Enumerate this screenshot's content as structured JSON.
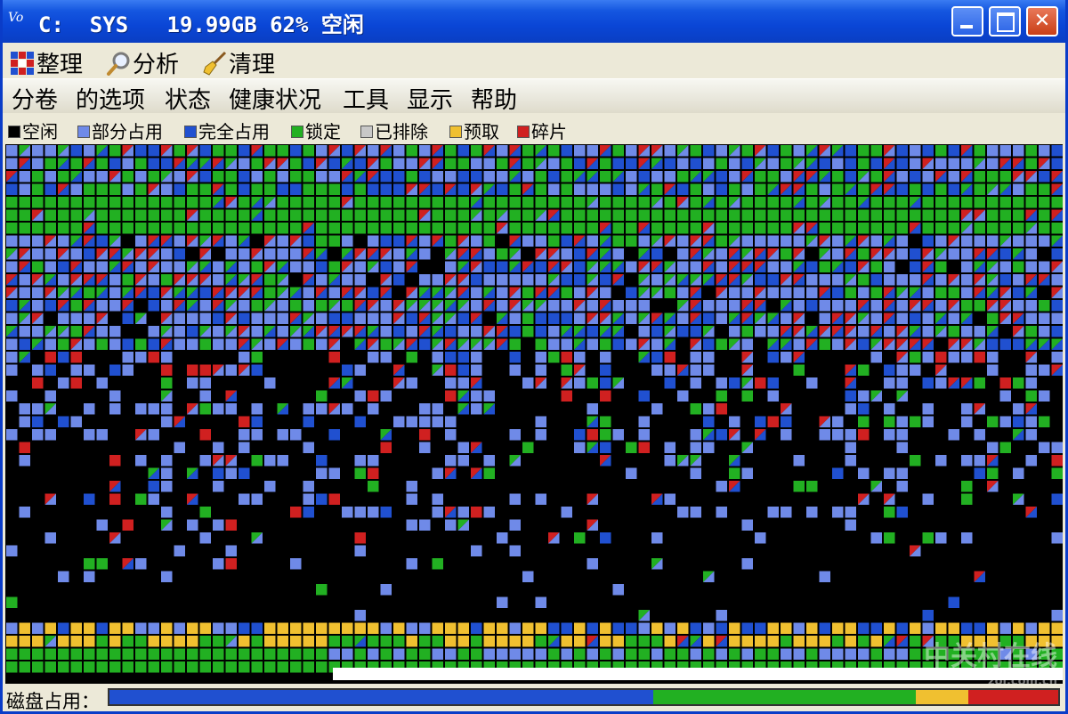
{
  "window": {
    "title": "C:  SYS   19.99GB 62% 空闲",
    "app_icon_text": "Vo",
    "minimize_glyph": "",
    "maximize_glyph": "",
    "close_glyph": "✕"
  },
  "toolbar": {
    "defrag_label": "整理",
    "analyze_label": "分析",
    "clean_label": "清理"
  },
  "menu": [
    "分卷",
    "的选项",
    "状态",
    "健康状况",
    "工具",
    "显示",
    "帮助"
  ],
  "legend": [
    {
      "label": "空闲",
      "color": "#000000"
    },
    {
      "label": "部分占用",
      "color": "#6f8ae8"
    },
    {
      "label": "完全占用",
      "color": "#2050d0"
    },
    {
      "label": "锁定",
      "color": "#22b022"
    },
    {
      "label": "已排除",
      "color": "#c8c8c8"
    },
    {
      "label": "预取",
      "color": "#f0c030"
    },
    {
      "label": "碎片",
      "color": "#d02020"
    }
  ],
  "colors": {
    "free": "#000000",
    "partial": "#6f8ae8",
    "full": "#2050d0",
    "locked": "#22b022",
    "prefetch": "#f0c030",
    "fragment": "#d02020",
    "accent_title": "#0a46d6"
  },
  "status": {
    "disk_usage_label": "磁盘占用：",
    "usage_segments": [
      {
        "color": "#2050d0",
        "fraction": 0.573
      },
      {
        "color": "#22b022",
        "fraction": 0.277
      },
      {
        "color": "#f0c030",
        "fraction": 0.055
      },
      {
        "color": "#d02020",
        "fraction": 0.095
      }
    ]
  },
  "watermark": {
    "main": "中关村在线",
    "sub": "zol.com.cn"
  }
}
